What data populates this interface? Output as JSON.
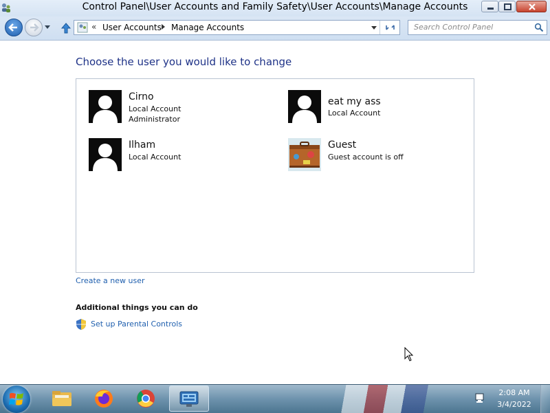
{
  "window": {
    "title": "Control Panel\\User Accounts and Family Safety\\User Accounts\\Manage Accounts"
  },
  "address_bar": {
    "overflow": "«",
    "crumbs": [
      "User Accounts",
      "Manage Accounts"
    ]
  },
  "search": {
    "placeholder": "Search Control Panel"
  },
  "main": {
    "heading": "Choose the user you would like to change",
    "users": [
      {
        "name": "Cirno",
        "lines": [
          "Local Account",
          "Administrator"
        ],
        "avatar": "silhouette"
      },
      {
        "name": "eat my ass",
        "lines": [
          "Local Account"
        ],
        "avatar": "silhouette"
      },
      {
        "name": "Ilham",
        "lines": [
          "Local Account"
        ],
        "avatar": "silhouette"
      },
      {
        "name": "Guest",
        "lines": [
          "Guest account is off"
        ],
        "avatar": "suitcase"
      }
    ],
    "create_link": "Create a new user",
    "additional_heading": "Additional things you can do",
    "parental_link": "Set up Parental Controls"
  },
  "taskbar": {
    "pinned": [
      "windows-explorer-icon",
      "firefox-icon",
      "chrome-icon",
      "control-panel-icon"
    ],
    "clock": {
      "time": "2:08 AM",
      "date": "3/4/2022"
    }
  },
  "colors": {
    "heading": "#1e3287",
    "link": "#1f5fae",
    "close_button": "#c8442f"
  }
}
